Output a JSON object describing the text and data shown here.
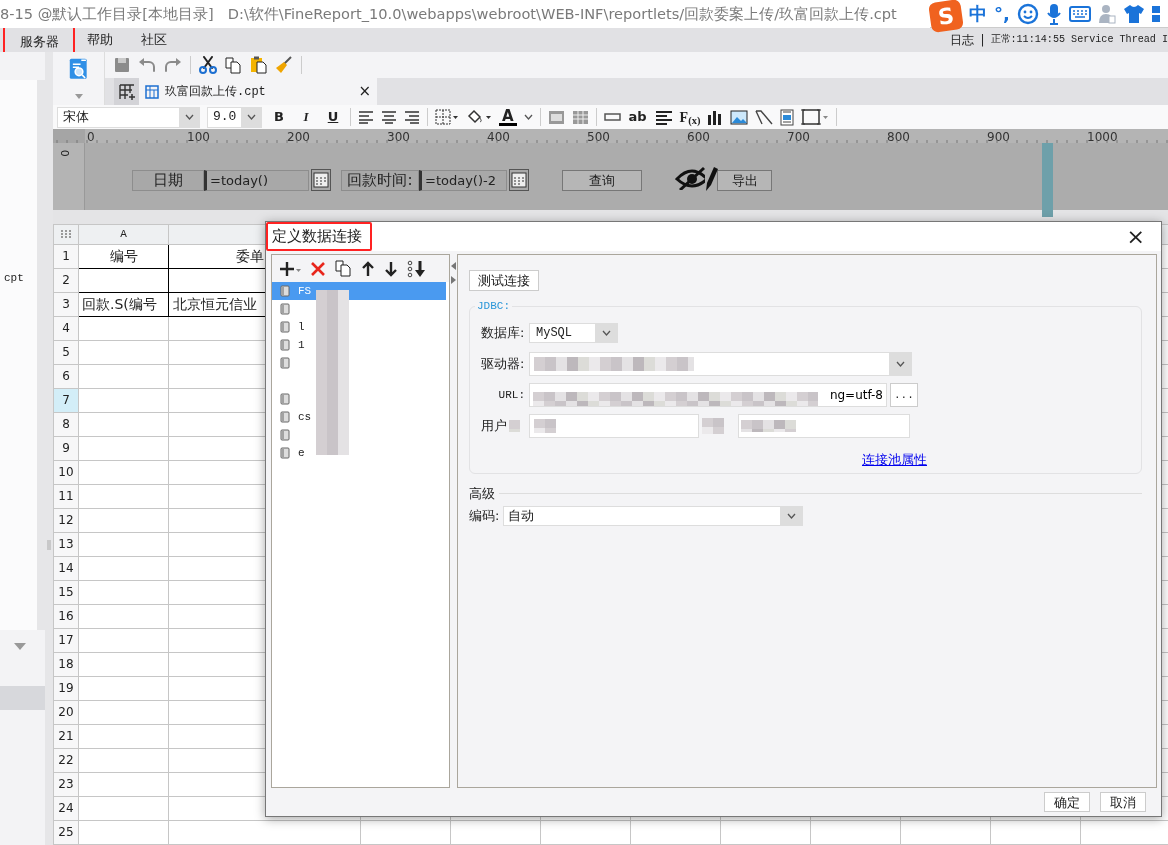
{
  "title_bar": {
    "text": "8-15 @默认工作目录[本地目录]",
    "path": "D:\\软件\\FineReport_10.0\\webapps\\webroot\\WEB-INF\\reportlets/回款委案上传/玖富回款上传.cpt"
  },
  "ime_toolbar": {
    "logo": "S",
    "mode": "中",
    "punctuation": "°,"
  },
  "menu": [
    {
      "label": "服务器",
      "annotated": true
    },
    {
      "label": "帮助",
      "annotated": false
    },
    {
      "label": "社区",
      "annotated": false
    }
  ],
  "status": {
    "log": "日志",
    "separator": "|",
    "message": "正常:11:14:55 Service Thread I"
  },
  "sidebar": {
    "file": "cpt"
  },
  "tab": {
    "label": "玖富回款上传.cpt",
    "close": "×"
  },
  "format_toolbar": {
    "font": "宋体",
    "size": "9.0",
    "bold": "B",
    "italic": "I",
    "underline": "U",
    "font_color": "A",
    "text_tool": "ab",
    "formula_tool": "F$_{(x)}$"
  },
  "ruler": {
    "marks": [
      "0",
      "100",
      "200",
      "300",
      "400",
      "500",
      "600",
      "700",
      "800",
      "900",
      "1000"
    ],
    "vertical": "0"
  },
  "parameters": [
    {
      "kind": "label",
      "text": "日期"
    },
    {
      "kind": "field",
      "value": "=today()"
    },
    {
      "kind": "calendar"
    },
    {
      "kind": "label",
      "text": "回款时间:"
    },
    {
      "kind": "field",
      "value": "=today()-2"
    },
    {
      "kind": "calendar"
    },
    {
      "kind": "button",
      "text": "查询"
    },
    {
      "kind": "button",
      "text": "导出"
    }
  ],
  "sheet": {
    "columns": [
      "A"
    ],
    "rows": [
      {
        "number": "1",
        "selected": false,
        "cells": [
          "编号",
          "委单"
        ]
      },
      {
        "number": "2",
        "selected": false,
        "cells": []
      },
      {
        "number": "3",
        "selected": false,
        "cells": [
          "回款.S(编号",
          "北京恒元信业"
        ]
      },
      {
        "number": "4",
        "selected": false
      },
      {
        "number": "5",
        "selected": false
      },
      {
        "number": "6",
        "selected": false
      },
      {
        "number": "7",
        "selected": true
      },
      {
        "number": "8",
        "selected": false
      },
      {
        "number": "9",
        "selected": false
      },
      {
        "number": "10",
        "selected": false
      },
      {
        "number": "11",
        "selected": false
      },
      {
        "number": "12",
        "selected": false
      },
      {
        "number": "13",
        "selected": false
      },
      {
        "number": "14",
        "selected": false
      },
      {
        "number": "15",
        "selected": false
      },
      {
        "number": "16",
        "selected": false
      },
      {
        "number": "17",
        "selected": false
      },
      {
        "number": "18",
        "selected": false
      },
      {
        "number": "19",
        "selected": false
      },
      {
        "number": "20",
        "selected": false
      },
      {
        "number": "21",
        "selected": false
      },
      {
        "number": "22",
        "selected": false
      },
      {
        "number": "23",
        "selected": false
      },
      {
        "number": "24",
        "selected": false
      },
      {
        "number": "25",
        "selected": false
      }
    ]
  },
  "dialog": {
    "title": "定义数据连接",
    "annotated": true,
    "close": "×",
    "connections": [
      {
        "label": "FS",
        "selected": true
      },
      {
        "selected": false
      },
      {
        "label": "l",
        "selected": false
      },
      {
        "label": "1",
        "selected": false
      },
      {
        "selected": false
      },
      {
        "selected": false
      },
      {
        "label": "cs",
        "selected": false
      },
      {
        "selected": false
      },
      {
        "label": "e",
        "selected": false
      }
    ],
    "test_button": "测试连接",
    "jdbc_legend": "JDBC:",
    "database_label": "数据库:",
    "database": "MySQL",
    "driver_label": "驱动器:",
    "url_label": "URL:",
    "url": "ng=utf-8",
    "url_more": "...",
    "user_label": "用户",
    "pool_link": "连接池属性",
    "advanced": "高级",
    "encoding_label": "编码:",
    "encoding": "自动",
    "ok": "确定",
    "cancel": "取消"
  }
}
